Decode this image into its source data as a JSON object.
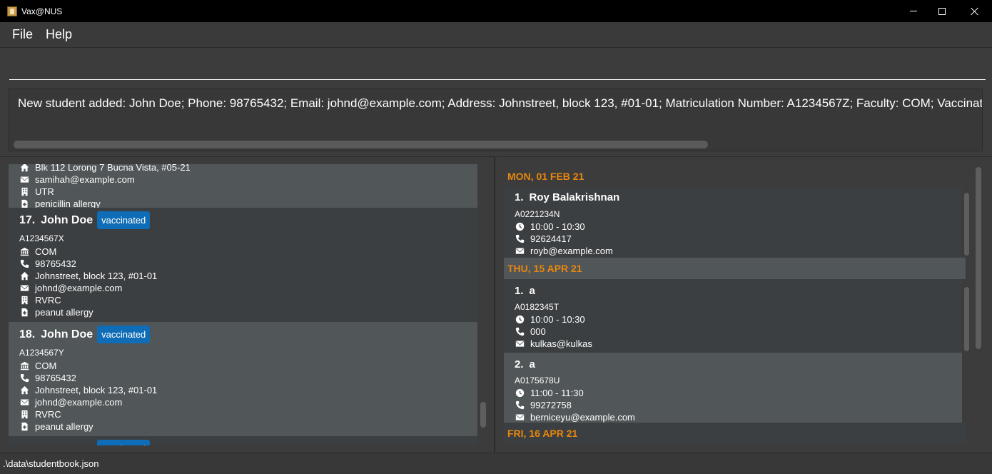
{
  "window": {
    "title": "Vax@NUS"
  },
  "menu": {
    "file": "File",
    "help": "Help"
  },
  "command": {
    "value": "",
    "placeholder": ""
  },
  "result": {
    "text": "New student added: John Doe; Phone: 98765432; Email: johnd@example.com; Address: Johnstreet, block 123, #01-01; Matriculation Number: A1234567Z; Faculty: COM; Vaccination Status"
  },
  "students": {
    "partial_top": {
      "address": "Blk 112 Lorong 7 Bucna Vista, #05-21",
      "email": "samihah@example.com",
      "residence": "UTR",
      "medical": "penicillin allergy"
    },
    "items": [
      {
        "index": "17.",
        "name": "John Doe",
        "status": "vaccinated",
        "matric": "A1234567X",
        "faculty": "COM",
        "phone": "98765432",
        "address": "Johnstreet, block 123, #01-01",
        "email": "johnd@example.com",
        "residence": "RVRC",
        "medical": "peanut allergy"
      },
      {
        "index": "18.",
        "name": "John Doe",
        "status": "vaccinated",
        "matric": "A1234567Y",
        "faculty": "COM",
        "phone": "98765432",
        "address": "Johnstreet, block 123, #01-01",
        "email": "johnd@example.com",
        "residence": "RVRC",
        "medical": "peanut allergy"
      }
    ],
    "partial_bottom": {
      "status": "vaccinated"
    }
  },
  "appointments": {
    "groups": [
      {
        "date": "MON, 01 FEB 21",
        "items": [
          {
            "index": "1.",
            "name": "Roy Balakrishnan",
            "matric": "A0221234N",
            "time": "10:00 - 10:30",
            "phone": "92624417",
            "email": "royb@example.com"
          }
        ]
      },
      {
        "date": "THU, 15 APR 21",
        "items": [
          {
            "index": "1.",
            "name": "a",
            "matric": "A0182345T",
            "time": "10:00 - 10:30",
            "phone": "000",
            "email": "kulkas@kulkas"
          },
          {
            "index": "2.",
            "name": "a",
            "matric": "A0175678U",
            "time": "11:00 - 11:30",
            "phone": "99272758",
            "email": "berniceyu@example.com"
          }
        ]
      },
      {
        "date": "FRI, 16 APR 21",
        "items": []
      }
    ]
  },
  "status_bar": {
    "path": ".\\data\\studentbook.json"
  },
  "colors": {
    "accent_badge": "#0f6cb6",
    "date_header": "#e8870e",
    "card_alt": "#515658",
    "background": "#3c3c3c"
  },
  "icons": {
    "faculty": "building-columns-icon",
    "phone": "phone-icon",
    "address": "home-icon",
    "email": "envelope-icon",
    "residence": "hotel-icon",
    "medical": "file-medical-icon",
    "time": "clock-icon"
  }
}
